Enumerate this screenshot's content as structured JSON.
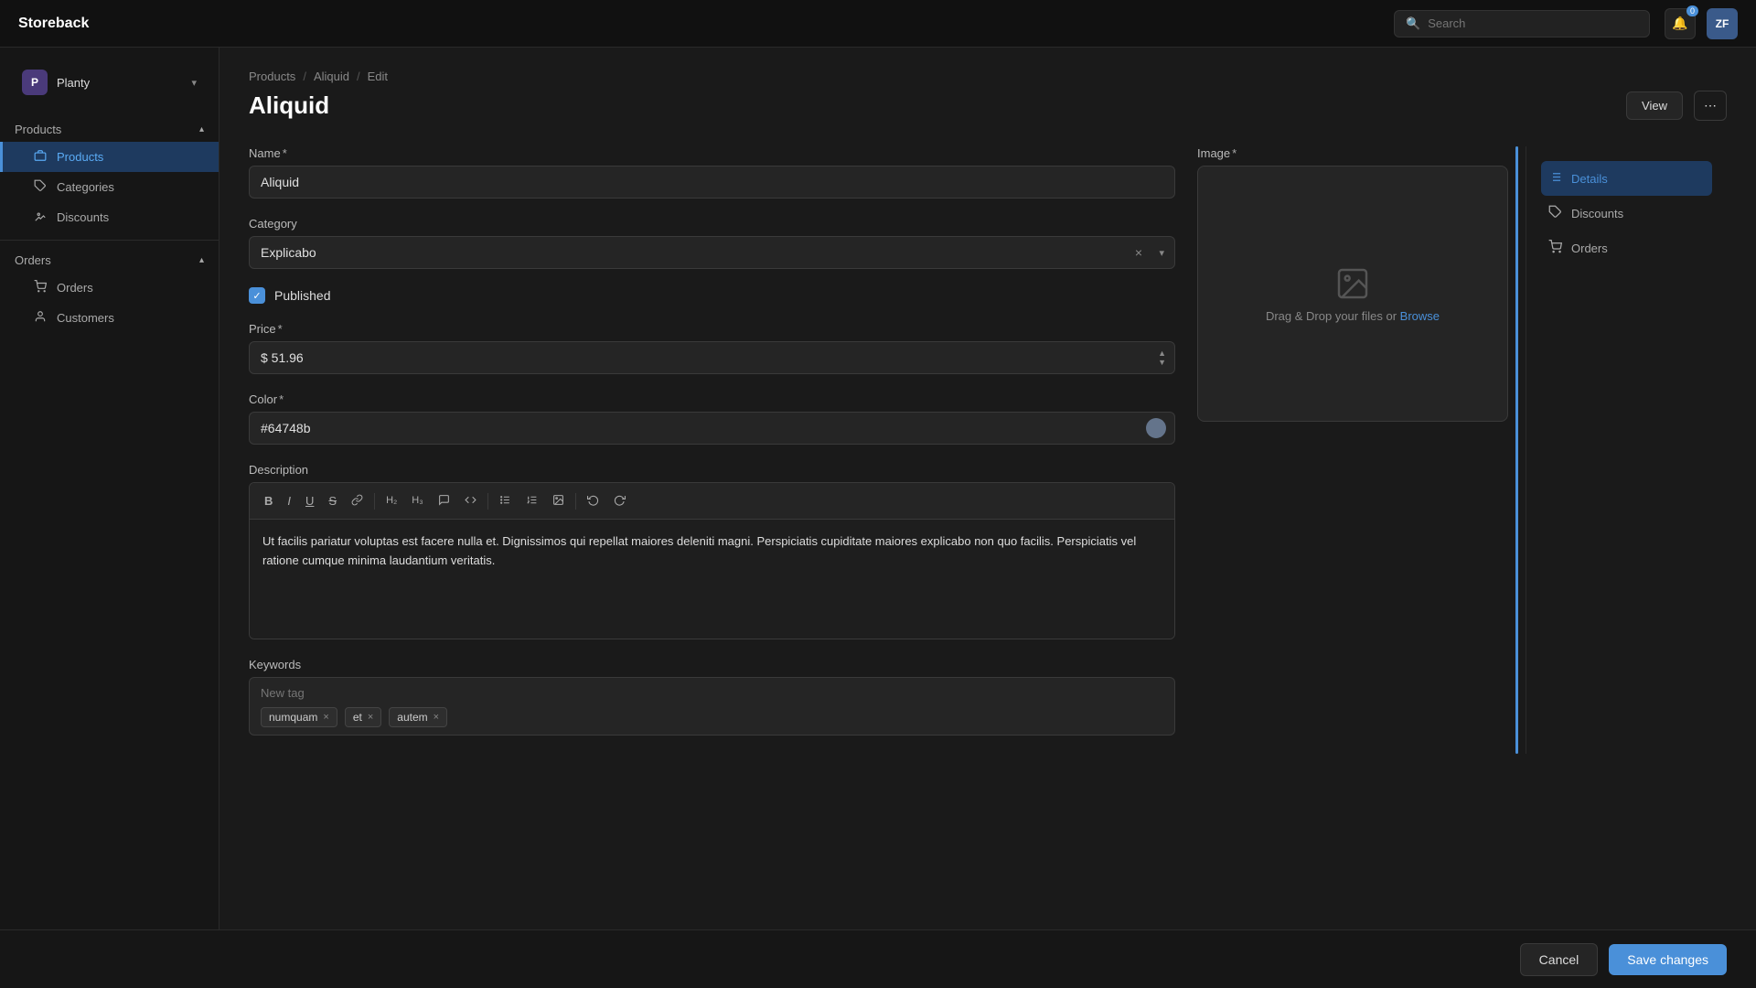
{
  "app": {
    "name": "Storeback"
  },
  "topbar": {
    "search_placeholder": "Search",
    "notif_count": "0",
    "user_initials": "ZF"
  },
  "sidebar": {
    "workspace": {
      "initial": "P",
      "name": "Planty"
    },
    "sections": [
      {
        "label": "Products",
        "items": [
          {
            "label": "Products",
            "active": true,
            "icon": "📦"
          },
          {
            "label": "Categories",
            "active": false,
            "icon": "🏷️"
          },
          {
            "label": "Discounts",
            "active": false,
            "icon": "🎫"
          }
        ]
      },
      {
        "label": "Orders",
        "items": [
          {
            "label": "Orders",
            "active": false,
            "icon": "🛒"
          },
          {
            "label": "Customers",
            "active": false,
            "icon": "👤"
          }
        ]
      }
    ]
  },
  "breadcrumb": {
    "parts": [
      "Products",
      "Aliquid",
      "Edit"
    ]
  },
  "page": {
    "title": "Aliquid",
    "view_label": "View"
  },
  "form": {
    "name_label": "Name",
    "name_value": "Aliquid",
    "category_label": "Category",
    "category_value": "Explicabo",
    "published_label": "Published",
    "published_checked": true,
    "price_label": "Price",
    "price_value": "$ 51.96",
    "color_label": "Color",
    "color_value": "#64748b",
    "color_hex": "#64748b",
    "description_label": "Description",
    "description_text": "Ut facilis pariatur voluptas est facere nulla et. Dignissimos qui repellat maiores deleniti magni. Perspiciatis cupiditate maiores explicabo non quo facilis. Perspiciatis vel ratione cumque minima laudantium veritatis.",
    "keywords_label": "Keywords",
    "keywords_placeholder": "New tag",
    "tags": [
      "numquam",
      "et",
      "autem"
    ],
    "image_label": "Image",
    "image_upload_text": "Drag & Drop your files or",
    "image_browse_label": "Browse"
  },
  "toolbar": {
    "buttons": [
      "B",
      "I",
      "U",
      "S",
      "🔗",
      "H₂",
      "H₃",
      "💬",
      "<>",
      "≡",
      "⋮≡",
      "🖼",
      "↩",
      "↪"
    ]
  },
  "right_panel": {
    "items": [
      {
        "label": "Details",
        "active": true,
        "icon": "list"
      },
      {
        "label": "Discounts",
        "active": false,
        "icon": "tag"
      },
      {
        "label": "Orders",
        "active": false,
        "icon": "cart"
      }
    ]
  },
  "bottom_bar": {
    "cancel_label": "Cancel",
    "save_label": "Save changes"
  }
}
